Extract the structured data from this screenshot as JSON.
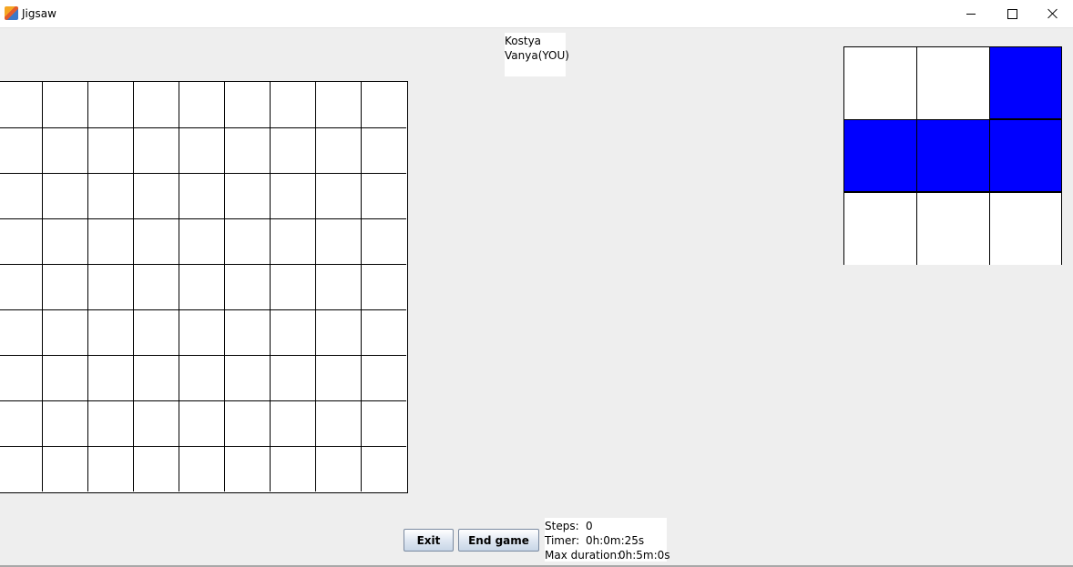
{
  "window": {
    "title": "Jigsaw",
    "icon": "java-icon"
  },
  "players": [
    "Kostya",
    "Vanya(YOU)"
  ],
  "board": {
    "rows": 9,
    "cols": 9
  },
  "piece": {
    "rows": 3,
    "cols": 3,
    "fill_color": "#0000ff",
    "cells": [
      [
        0,
        0,
        1
      ],
      [
        1,
        1,
        1
      ],
      [
        0,
        0,
        0
      ]
    ]
  },
  "buttons": {
    "exit": "Exit",
    "end_game": "End game"
  },
  "stats": {
    "steps_label": "Steps:",
    "steps_value": "0",
    "timer_label": "Timer:",
    "timer_value": "0h:0m:25s",
    "max_label": "Max duration:",
    "max_value": "0h:5m:0s"
  }
}
